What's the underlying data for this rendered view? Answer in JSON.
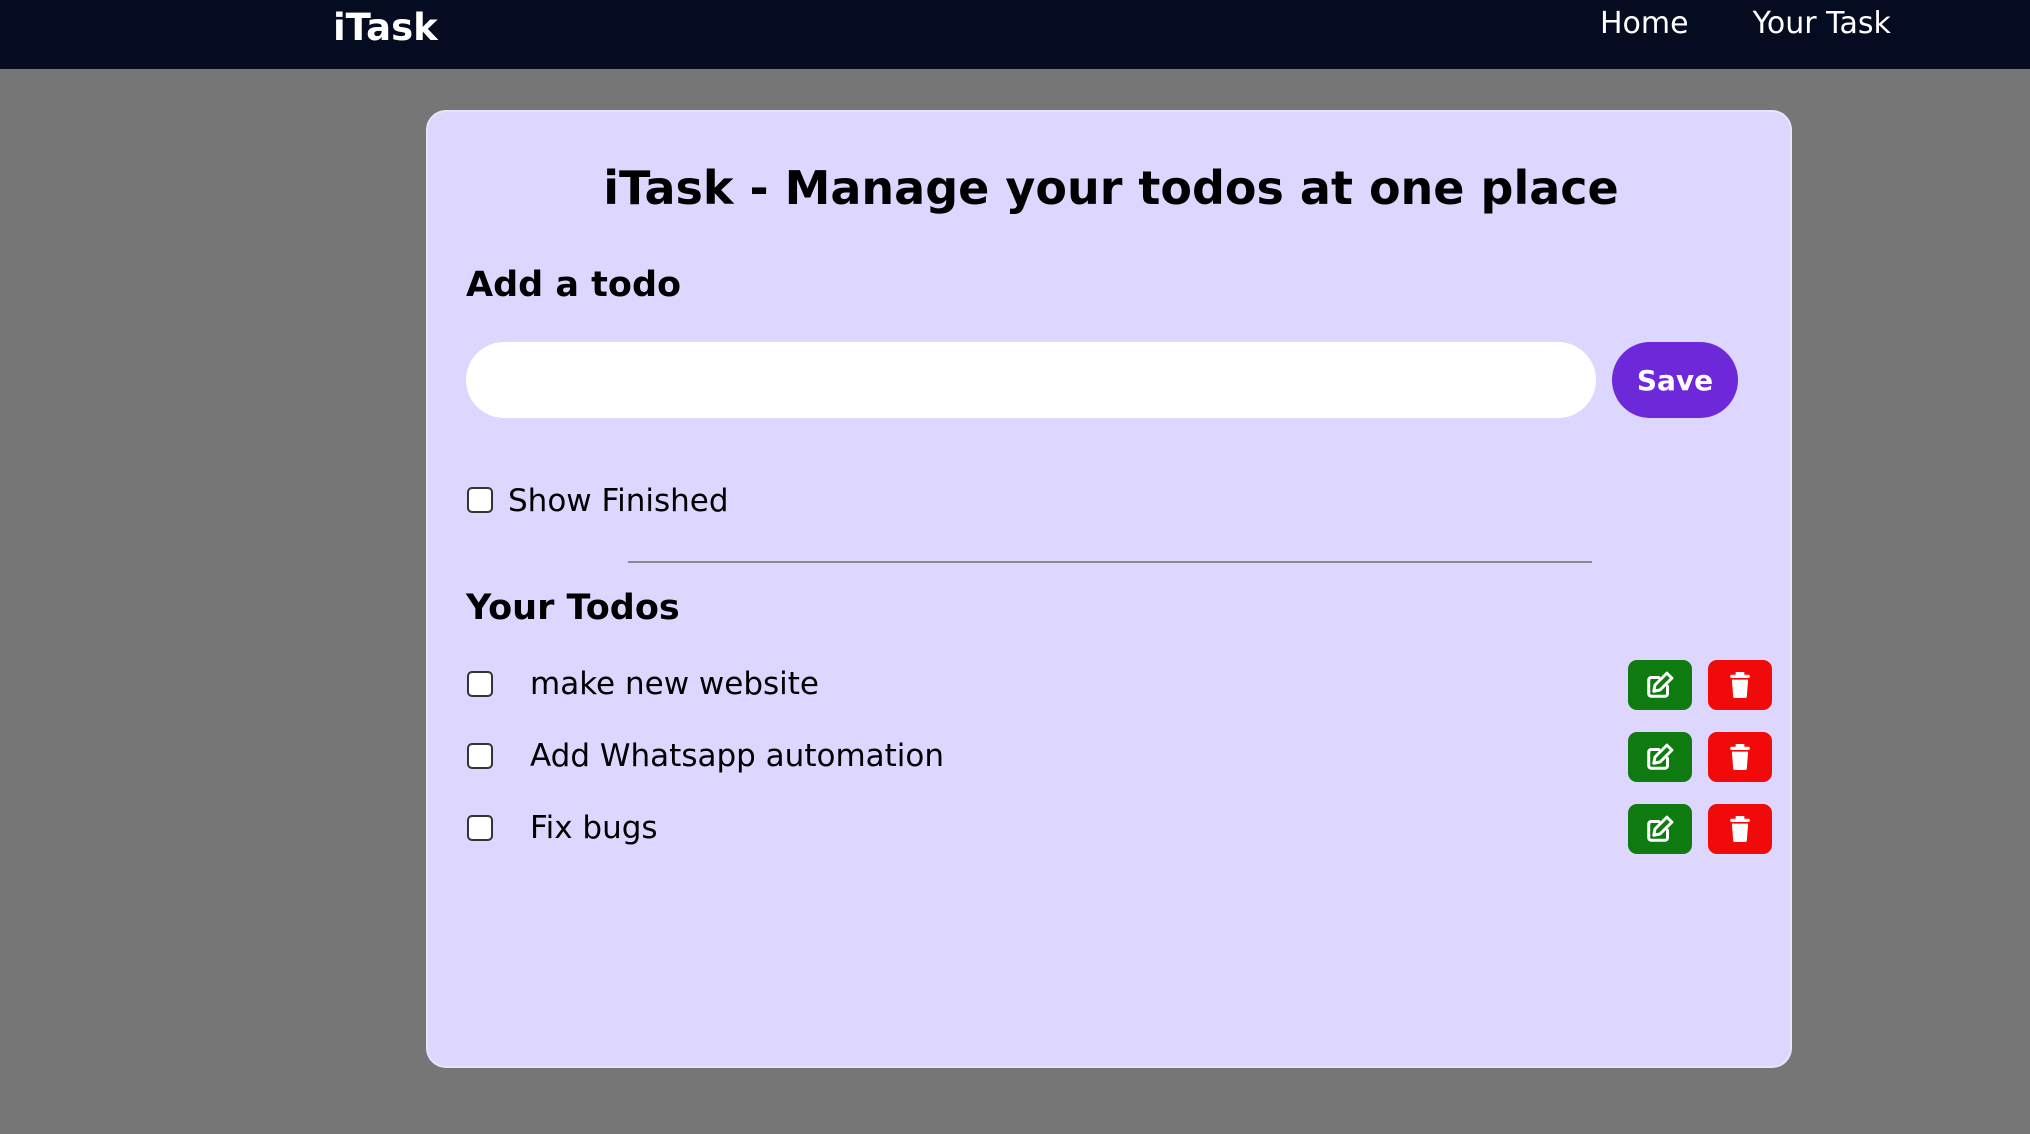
{
  "navbar": {
    "brand": "iTask",
    "links": [
      {
        "label": "Home"
      },
      {
        "label": "Your Task"
      }
    ]
  },
  "card": {
    "title": "iTask - Manage your todos at one place",
    "add_title": "Add a todo",
    "input_value": "",
    "save_label": "Save",
    "show_finished_label": "Show Finished",
    "show_finished_checked": false,
    "todos_title": "Your Todos"
  },
  "todos": [
    {
      "text": "make new website",
      "checked": false
    },
    {
      "text": "Add Whatsapp automation",
      "checked": false
    },
    {
      "text": "Fix bugs",
      "checked": false
    }
  ],
  "icons": {
    "edit": "edit-icon",
    "delete": "trash-icon"
  },
  "colors": {
    "navbar": "#050c22",
    "background": "#767676",
    "card": "#ddd6fe",
    "save_button": "#6d28d9",
    "edit_button": "#0f7a0f",
    "delete_button": "#f20a0a"
  }
}
